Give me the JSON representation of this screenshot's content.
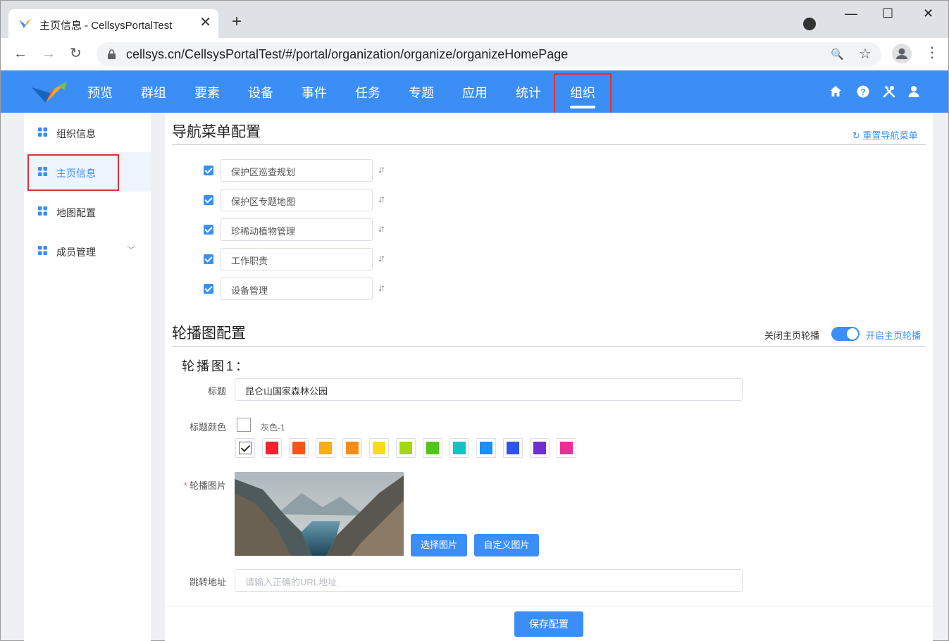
{
  "browser": {
    "tab_title": "主页信息 - CellsysPortalTest",
    "tab_close": "✕",
    "new_tab": "+",
    "url": "cellsys.cn/CellsysPortalTest/#/portal/organization/organize/organizeHomePage",
    "back": "←",
    "forward": "→",
    "reload": "↻",
    "zoom": "🔍",
    "star": "☆",
    "menu": "⋮",
    "minimize": "—",
    "maximize": "☐",
    "close": "✕"
  },
  "nav": {
    "items": [
      "预览",
      "群组",
      "要素",
      "设备",
      "事件",
      "任务",
      "专题",
      "应用",
      "统计",
      "组织"
    ],
    "active_index": 9
  },
  "sidebar": {
    "items": [
      {
        "label": "组织信息"
      },
      {
        "label": "主页信息"
      },
      {
        "label": "地图配置"
      },
      {
        "label": "成员管理"
      }
    ],
    "active_index": 1,
    "chevron": "﹀"
  },
  "nav_menu_config": {
    "title": "导航菜单配置",
    "reset_label": "重置导航菜单",
    "reset_icon": "↻",
    "sort_glyph": "↓↑",
    "items": [
      {
        "label": "保护区巡查规划",
        "checked": true
      },
      {
        "label": "保护区专题地图",
        "checked": true
      },
      {
        "label": "珍稀动植物管理",
        "checked": true
      },
      {
        "label": "工作职责",
        "checked": true
      },
      {
        "label": "设备管理",
        "checked": true
      }
    ]
  },
  "carousel_config": {
    "title": "轮播图配置",
    "off_label": "关闭主页轮播",
    "on_label": "开启主页轮播",
    "enabled": true,
    "slide": {
      "heading": "轮播图1：",
      "title_label": "标题",
      "title_value": "昆仑山国家森林公园",
      "color_label": "标题颜色",
      "color_name": "灰色-1",
      "image_label": "轮播图片",
      "required_mark": "*",
      "choose_image": "选择图片",
      "custom_image": "自定义图片",
      "url_label": "跳转地址",
      "url_placeholder": "请输入正确的URL地址"
    },
    "colors": [
      "#ffffff",
      "#f5222d",
      "#fa541c",
      "#faad14",
      "#fa8c16",
      "#fadb14",
      "#a0d911",
      "#52c41a",
      "#13c2c2",
      "#1890ff",
      "#2f54eb",
      "#722ed1",
      "#eb2f96"
    ]
  },
  "footer": {
    "save_label": "保存配置"
  },
  "colors": {
    "primary": "#3b8ef5",
    "highlight": "#e03131"
  }
}
